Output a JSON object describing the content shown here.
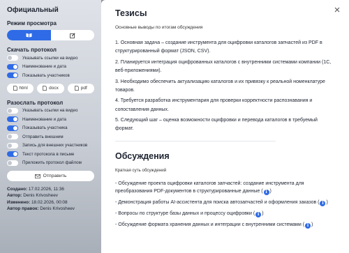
{
  "sidebar": {
    "title": "Официальный",
    "view_mode": {
      "label": "Режим просмотра",
      "options": [
        {
          "icon": "book-icon",
          "active": true
        },
        {
          "icon": "edit-icon",
          "active": false
        }
      ]
    },
    "download": {
      "label": "Скачать протокол",
      "toggles": [
        {
          "label": "Указывать ссылки на видео",
          "on": false
        },
        {
          "label": "Наименование и дата",
          "on": true
        },
        {
          "label": "Показывать участников",
          "on": true
        }
      ],
      "formats": [
        "html",
        "docx",
        "pdf"
      ]
    },
    "send": {
      "label": "Разослать протокол",
      "toggles": [
        {
          "label": "Указывать ссылки на видео",
          "on": false
        },
        {
          "label": "Наименование и дата",
          "on": true
        },
        {
          "label": "Показывать участника",
          "on": true
        },
        {
          "label": "Отправить внешним",
          "on": false
        },
        {
          "label": "Запись для внешних участников",
          "on": false
        },
        {
          "label": "Текст протокола в письме",
          "on": true
        },
        {
          "label": "Приложить протокол файлом",
          "on": false
        }
      ],
      "button_label": "Отправить"
    },
    "meta": {
      "created_label": "Создано:",
      "created_value": "17.02.2026, 11:36",
      "author_label": "Автор:",
      "author_value": "Denis Krivosheev",
      "changed_label": "Изменено:",
      "changed_value": "18.02.2026, 00:08",
      "editor_label": "Автор правок:",
      "editor_value": "Denis Krivosheev"
    }
  },
  "main": {
    "theses": {
      "title": "Тезисы",
      "subtitle": "Основные выводы по итогам обсуждения",
      "items": [
        "1. Основная задача – создание инструмента для оцифровки каталогов запчастей из PDF в структурированный формат (JSON, CSV).",
        "2. Планируется интеграция оцифрованных каталогов с внутренними системами компании (1С, веб-приложениями).",
        "3. Необходимо обеспечить актуализацию каталогов и их привязку к реальной номенклатуре товаров.",
        "4. Требуется разработка инструментария для проверки корректности распознавания и сопоставления данных.",
        "5. Следующий шаг – оценка возможности оцифровки и перевода каталогов в требуемый формат."
      ]
    },
    "discussions": {
      "title": "Обсуждения",
      "subtitle": "Краткая суть обсуждений",
      "items": [
        "- Обсуждение проекта оцифровки каталогов запчастей: создание инструмента для преобразования PDF-документов в структурированные данные (",
        "- Демонстрация работы AI-ассистента для поиска автозапчастей и оформления заказов (",
        "- Вопросы по структуре базы данных и процессу оцифровки (",
        "- Обсуждение формата хранения данных и интеграции с внутренними системами ("
      ],
      "info_glyph": "i",
      "closing": ")"
    }
  },
  "colors": {
    "accent": "#2f6be6"
  }
}
